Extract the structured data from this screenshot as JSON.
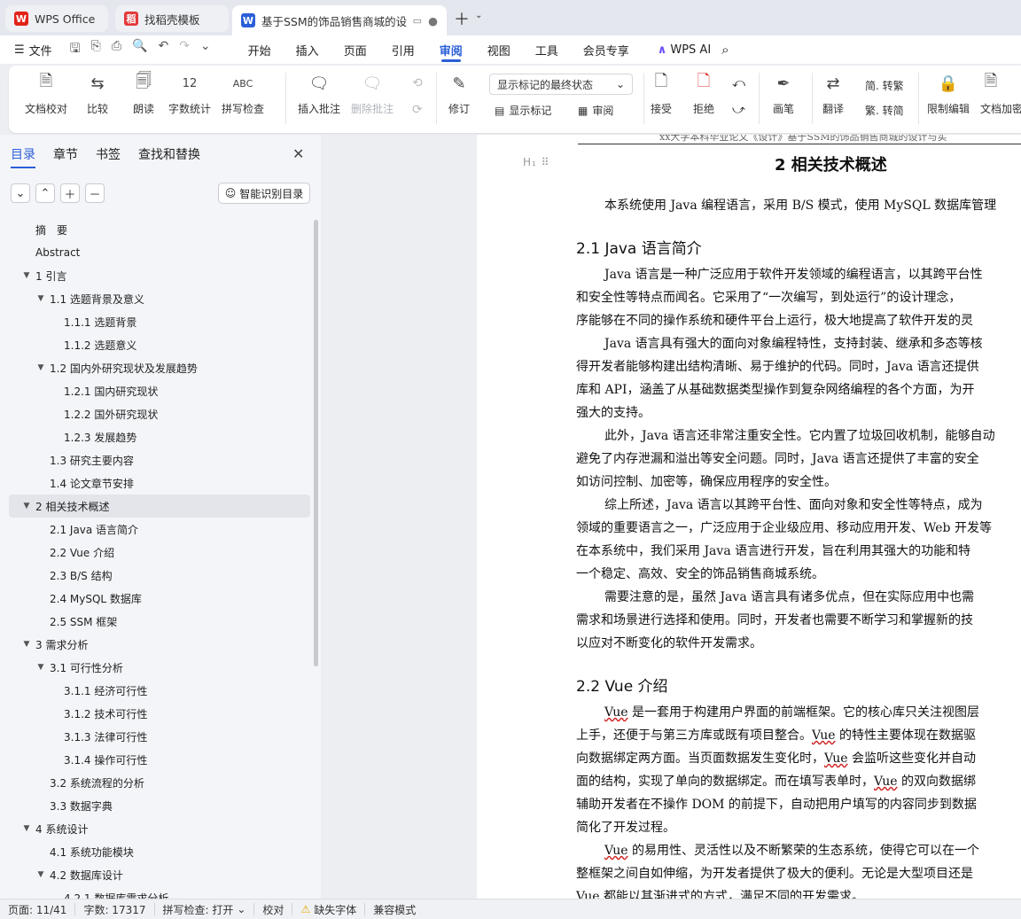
{
  "tabs": [
    {
      "label": "WPS Office",
      "icon": "wps-icon"
    },
    {
      "label": "找稻壳模板",
      "icon": "docer-icon"
    },
    {
      "label": "基于SSM的饰品销售商城的设",
      "icon": "word-doc-icon"
    }
  ],
  "menubar": {
    "file": "文件",
    "tabs": [
      "开始",
      "插入",
      "页面",
      "引用",
      "审阅",
      "视图",
      "工具",
      "会员专享"
    ],
    "active": "审阅",
    "wps_ai": "WPS AI"
  },
  "ribbon": {
    "doc_check": "文档校对",
    "compare": "比较",
    "read_aloud": "朗读",
    "word_count": "字数统计",
    "spell_check": "拼写检查",
    "insert_comment": "插入批注",
    "delete_comment": "删除批注",
    "revise": "修订",
    "markup_select": "显示标记的最终状态",
    "show_markup": "显示标记",
    "review": "审阅",
    "accept": "接受",
    "reject": "拒绝",
    "pen": "画笔",
    "translate": "翻译",
    "to_trad": "简. 转繁",
    "to_simp": "繁. 转简",
    "restrict_edit": "限制编辑",
    "doc_encrypt": "文档加密"
  },
  "panel": {
    "tabs": [
      "目录",
      "章节",
      "书签",
      "查找和替换"
    ],
    "smart_toc": "智能识别目录",
    "toc": [
      {
        "label": "摘　要",
        "level": 1,
        "arrow": ""
      },
      {
        "label": "Abstract",
        "level": 1,
        "arrow": ""
      },
      {
        "label": "1  引言",
        "level": 1,
        "arrow": "▼"
      },
      {
        "label": "1.1  选题背景及意义",
        "level": 2,
        "arrow": "▼"
      },
      {
        "label": "1.1.1  选题背景",
        "level": 3,
        "arrow": ""
      },
      {
        "label": "1.1.2  选题意义",
        "level": 3,
        "arrow": ""
      },
      {
        "label": "1.2  国内外研究现状及发展趋势",
        "level": 2,
        "arrow": "▼"
      },
      {
        "label": "1.2.1  国内研究现状",
        "level": 3,
        "arrow": ""
      },
      {
        "label": "1.2.2  国外研究现状",
        "level": 3,
        "arrow": ""
      },
      {
        "label": "1.2.3  发展趋势",
        "level": 3,
        "arrow": ""
      },
      {
        "label": "1.3  研究主要内容",
        "level": 2,
        "arrow": ""
      },
      {
        "label": "1.4  论文章节安排",
        "level": 2,
        "arrow": ""
      },
      {
        "label": "2  相关技术概述",
        "level": 1,
        "arrow": "▼",
        "selected": true
      },
      {
        "label": "2.1 Java 语言简介",
        "level": 2,
        "arrow": ""
      },
      {
        "label": "2.2 Vue 介绍",
        "level": 2,
        "arrow": ""
      },
      {
        "label": "2.3 B/S 结构",
        "level": 2,
        "arrow": ""
      },
      {
        "label": "2.4 MySQL 数据库",
        "level": 2,
        "arrow": ""
      },
      {
        "label": "2.5 SSM 框架",
        "level": 2,
        "arrow": ""
      },
      {
        "label": "3 需求分析",
        "level": 1,
        "arrow": "▼"
      },
      {
        "label": "3.1  可行性分析",
        "level": 2,
        "arrow": "▼"
      },
      {
        "label": "3.1.1  经济可行性",
        "level": 3,
        "arrow": ""
      },
      {
        "label": "3.1.2  技术可行性",
        "level": 3,
        "arrow": ""
      },
      {
        "label": "3.1.3  法律可行性",
        "level": 3,
        "arrow": ""
      },
      {
        "label": "3.1.4  操作可行性",
        "level": 3,
        "arrow": ""
      },
      {
        "label": "3.2 系统流程的分析",
        "level": 2,
        "arrow": ""
      },
      {
        "label": "3.3  数据字典",
        "level": 2,
        "arrow": ""
      },
      {
        "label": "4 系统设计",
        "level": 1,
        "arrow": "▼"
      },
      {
        "label": "4.1 系统功能模块",
        "level": 2,
        "arrow": ""
      },
      {
        "label": "4.2  数据库设计",
        "level": 2,
        "arrow": "▼"
      },
      {
        "label": "4.2.1  数据库需求分析",
        "level": 3,
        "arrow": ""
      }
    ]
  },
  "doc": {
    "header": "xx大学本科毕业论文《设计》基于SSM的饰品销售商城的设计与实",
    "h1": "2  相关技术概述",
    "intro": "本系统使用 Java 编程语言，采用 B/S 模式，使用 MySQL 数据库管理",
    "h2_1": "2.1 Java 语言简介",
    "sec1": [
      "Java 语言是一种广泛应用于软件开发领域的编程语言，以其跨平台性",
      "和安全性等特点而闻名。它采用了“一次编写，到处运行”的设计理念，",
      "序能够在不同的操作系统和硬件平台上运行，极大地提高了软件开发的灵",
      "Java 语言具有强大的面向对象编程特性，支持封装、继承和多态等核",
      "得开发者能够构建出结构清晰、易于维护的代码。同时，Java 语言还提供",
      "库和 API，涵盖了从基础数据类型操作到复杂网络编程的各个方面，为开",
      "强大的支持。",
      "此外，Java 语言还非常注重安全性。它内置了垃圾回收机制，能够自动",
      "避免了内存泄漏和溢出等安全问题。同时，Java 语言还提供了丰富的安全",
      "如访问控制、加密等，确保应用程序的安全性。",
      "综上所述，Java 语言以其跨平台性、面向对象和安全性等特点，成为",
      "领域的重要语言之一，广泛应用于企业级应用、移动应用开发、Web 开发等",
      "在本系统中，我们采用 Java 语言进行开发，旨在利用其强大的功能和特",
      "一个稳定、高效、安全的饰品销售商城系统。",
      "需要注意的是，虽然 Java 语言具有诸多优点，但在实际应用中也需",
      "需求和场景进行选择和使用。同时，开发者也需要不断学习和掌握新的技",
      "以应对不断变化的软件开发需求。"
    ],
    "h2_2": "2.2 Vue 介绍",
    "sec2": [
      "Vue 是一套用于构建用户界面的前端框架。它的核心库只关注视图层",
      "上手，还便于与第三方库或既有项目整合。Vue 的特性主要体现在数据驱",
      "向数据绑定两方面。当页面数据发生变化时，Vue 会监听这些变化并自动",
      "面的结构，实现了单向的数据绑定。而在填写表单时，Vue 的双向数据绑",
      "辅助开发者在不操作 DOM 的前提下，自动把用户填写的内容同步到数据",
      "简化了开发过程。",
      "Vue 的易用性、灵活性以及不断繁荣的生态系统，使得它可以在一个",
      "整框架之间自如伸缩，为开发者提供了极大的便利。无论是大型项目还是",
      "Vue 都能以其渐进式的方式，满足不同的开发需求。"
    ]
  },
  "status": {
    "page": "页面: 11/41",
    "words": "字数: 17317",
    "spell": "拼写检查: 打开",
    "proof": "校对",
    "missing_font": "缺失字体",
    "compat": "兼容模式"
  },
  "colors": {
    "accent": "#2b5fd9",
    "wps_red": "#e2231a",
    "doc_blue": "#2b5fd9",
    "warn": "#e6a700"
  }
}
